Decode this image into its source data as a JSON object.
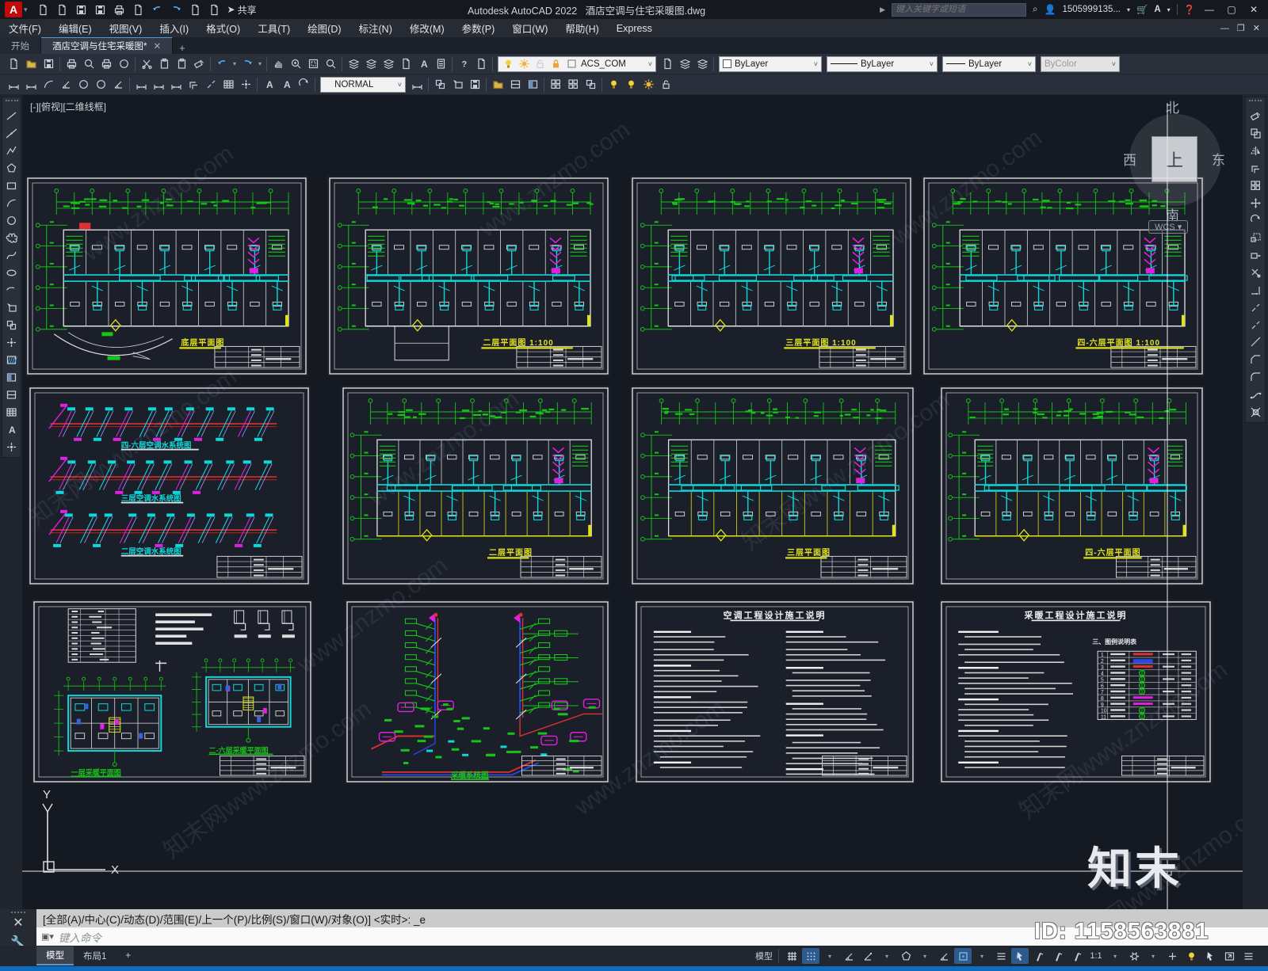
{
  "titlebar": {
    "logo": "A",
    "app_title": "Autodesk AutoCAD 2022",
    "doc_title": "酒店空调与住宅采暖图.dwg",
    "share_label": "共享",
    "search_placeholder": "键入关键字或短语",
    "account": "1505999135...",
    "window_controls": {
      "minimize": "—",
      "maximize": "▢",
      "close": "✕"
    },
    "doc_window_controls": {
      "minimize": "—",
      "restore": "❐",
      "close": "✕"
    }
  },
  "quick_access_icons": [
    "new-file-icon",
    "open-file-icon",
    "save-icon",
    "save-as-icon",
    "plot-icon",
    "print-preview-icon",
    "undo-icon",
    "redo-icon",
    "customize-caret-icon",
    "share-plane-icon"
  ],
  "menus": [
    "文件(F)",
    "编辑(E)",
    "视图(V)",
    "插入(I)",
    "格式(O)",
    "工具(T)",
    "绘图(D)",
    "标注(N)",
    "修改(M)",
    "参数(P)",
    "窗口(W)",
    "帮助(H)",
    "Express"
  ],
  "file_tabs": {
    "start": "开始",
    "document": "酒店空调与住宅采暖图*",
    "close": "✕",
    "add": "+"
  },
  "toolbar_row1_icons": [
    "new",
    "open",
    "save",
    "sep",
    "plot",
    "preview",
    "publish",
    "globe",
    "sep",
    "cut",
    "copy",
    "paste",
    "matchprop",
    "sep",
    "undo",
    "caret",
    "redo",
    "caret",
    "sep",
    "pan",
    "zoom",
    "zoomwin",
    "zoomprev",
    "sep",
    "layerprops",
    "layermgr",
    "layeriso",
    "sheetset",
    "markup",
    "calc",
    "sep",
    "help",
    "share2",
    "sep"
  ],
  "toolbar_row1_layerbox_icons": [
    "bulb",
    "sun",
    "lockui",
    "lock",
    "sqbox"
  ],
  "toolbar_row1_after_layer_icons": [
    "layers",
    "layerprev",
    "layerstate"
  ],
  "toolbar_row2_icons": [
    "dimlinear",
    "dimaligned",
    "dimarc",
    "dimordinate",
    "dimradius",
    "dimdiameter",
    "dimangular",
    "sep",
    "qdim",
    "dimbaseline",
    "dimcontinue",
    "dimspace",
    "dimbreak",
    "tolerance",
    "dimcenter",
    "sep",
    "dimedit",
    "dimtedit",
    "dimupdate",
    "sep"
  ],
  "toolbar_row2_after_combo_icons": [
    "dimstyle",
    "sep",
    "blockmake",
    "blockinsert",
    "wblock",
    "sep",
    "xattach",
    "xclip",
    "xadjust",
    "sep",
    "groupadd",
    "groupsel",
    "groupbox",
    "sep",
    "isolateobj",
    "hideobj",
    "showobj",
    "endiso"
  ],
  "combos": {
    "layer": "ACS_COM",
    "color": "ByLayer",
    "linetype": "ByLayer",
    "lineweight": "ByLayer",
    "plotstyle": "ByColor",
    "dimstyle": "NORMAL"
  },
  "draw_toolbar_icons": [
    "line",
    "xline",
    "pline",
    "polygon",
    "rectangle",
    "arc",
    "circle",
    "revcloud",
    "spline",
    "ellipse",
    "ellipsearc",
    "insblock",
    "mkblock",
    "point",
    "hatch",
    "gradient",
    "region",
    "table",
    "mtext",
    "pointstyle"
  ],
  "modify_toolbar_icons": [
    "erase",
    "copyobj",
    "mirror",
    "offset",
    "array",
    "move",
    "rotate",
    "scale",
    "stretch",
    "trim",
    "extend",
    "breakpt",
    "break",
    "join",
    "chamfer",
    "fillet",
    "blend",
    "explode"
  ],
  "viewport_label": "[-][俯视][二维线框]",
  "viewcube": {
    "north": "北",
    "south": "南",
    "east": "东",
    "west": "西",
    "top": "上",
    "wcs": "WCS"
  },
  "sheets": [
    {
      "title": "底层平面图"
    },
    {
      "title": "二层平面图 1:100"
    },
    {
      "title": "三层平面图 1:100"
    },
    {
      "title": "四-六层平面图 1:100"
    },
    {
      "titles": [
        "四-六层空调水系统图",
        "三层空调水系统图",
        "二层空调水系统图"
      ]
    },
    {
      "title": "二层平面图"
    },
    {
      "title": "三层平面图"
    },
    {
      "title": "四-六层平面图"
    },
    {
      "titles": [
        "一层采暖平面图",
        "二-六层采暖平面图"
      ]
    },
    {
      "title": "采暖系统图"
    },
    {
      "title": "空调工程设计施工说明"
    },
    {
      "title": "采暖工程设计施工说明",
      "legend_title": "三、图例说明表"
    }
  ],
  "ucs": {
    "x": "X",
    "y": "Y"
  },
  "command": {
    "history": "[全部(A)/中心(C)/动态(D)/范围(E)/上一个(P)/比例(S)/窗口(W)/对象(O)] <实时>: _e",
    "placeholder": "键入命令"
  },
  "layout_tabs": [
    "模型",
    "布局1",
    "+"
  ],
  "statusbar": {
    "model_label": "模型",
    "scale": "1:1"
  },
  "status_icons": [
    "grid",
    "snap.on",
    "caret",
    "ortho",
    "polar",
    "caret",
    "isodraft",
    "caret",
    "otrack",
    "osnap.on",
    "caret",
    "lwt",
    "dyninput.on",
    "annovis",
    "annoauto",
    "annoscale",
    "scaletext",
    "caret",
    "gear",
    "caret",
    "plus",
    "isolate",
    "perf",
    "fullscreen",
    "hamburger"
  ],
  "watermarks": {
    "id": "ID: 1158563881",
    "logo": "知末",
    "diagonal_texts": [
      "www.znzmo.com",
      "知末网www.znzmo.com"
    ]
  },
  "accent_colors": {
    "green": "#17c317",
    "cyan": "#0fd8d8",
    "yellow": "#e3e31a",
    "magenta": "#e020e0",
    "red": "#e03030",
    "blue": "#3050ff",
    "white": "#e6e6e6"
  }
}
